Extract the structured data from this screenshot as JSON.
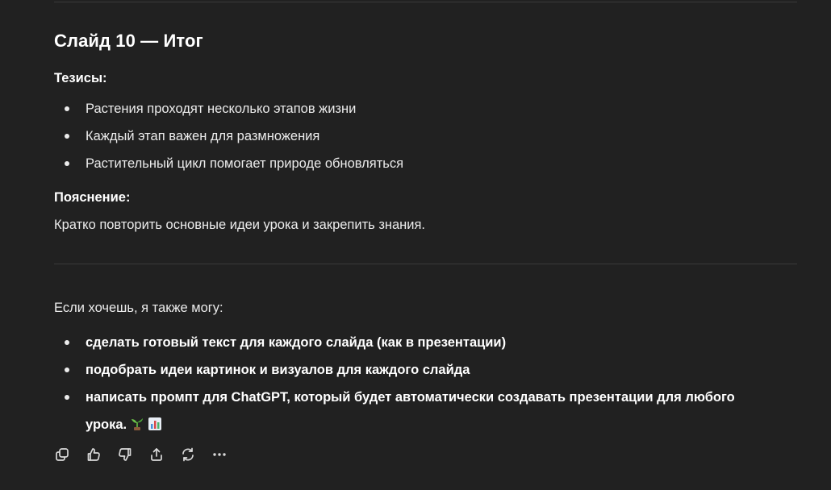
{
  "slide": {
    "title": "Слайд 10 — Итог",
    "theses_label": "Тезисы:",
    "theses": [
      "Растения проходят несколько этапов жизни",
      "Каждый этап важен для размножения",
      "Растительный цикл помогает природе обновляться"
    ],
    "explanation_label": "Пояснение:",
    "explanation": "Кратко повторить основные идеи урока и закрепить знания."
  },
  "offer": {
    "intro": "Если хочешь, я также могу:",
    "items": [
      "сделать готовый текст для каждого слайда (как в презентации)",
      "подобрать идеи картинок и визуалов для каждого слайда",
      "написать промпт для ChatGPT, который будет автоматически создавать презентации для любого урока."
    ],
    "trailing_emojis": [
      "seedling-emoji",
      "bar-chart-emoji"
    ]
  },
  "actions": [
    "copy-icon",
    "thumbs-up-icon",
    "thumbs-down-icon",
    "share-icon",
    "regenerate-icon",
    "more-icon"
  ],
  "colors": {
    "background": "#212121",
    "text": "#ececec",
    "heading": "#ffffff",
    "divider": "#3a3a3a",
    "icon": "#d9d9d9"
  }
}
